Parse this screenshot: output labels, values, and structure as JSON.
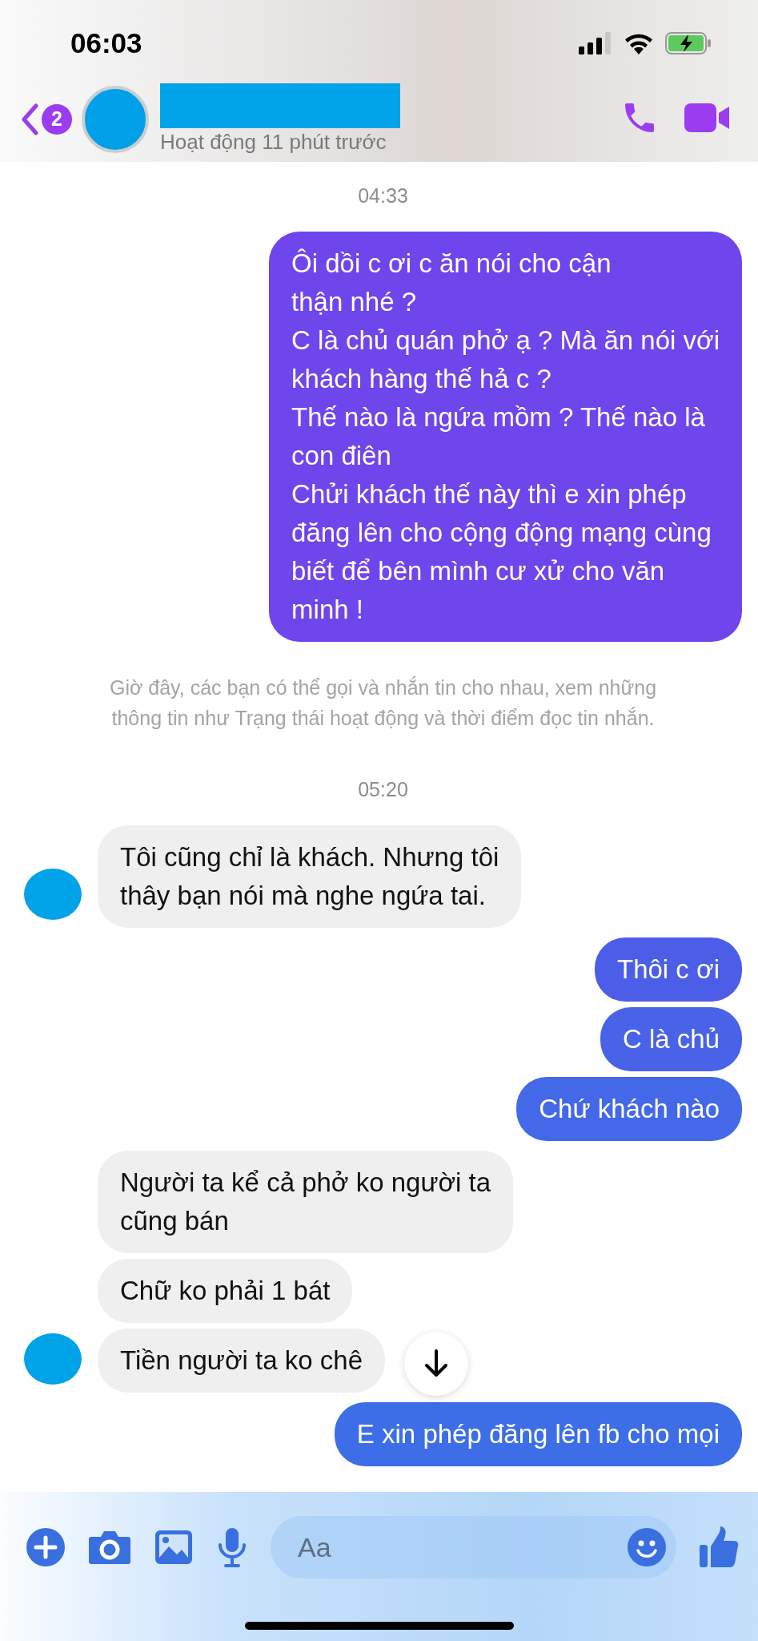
{
  "status_bar": {
    "time": "06:03"
  },
  "header": {
    "unread_badge": "2",
    "status": "Hoạt động 11 phút trước"
  },
  "messages": [
    {
      "kind": "time",
      "text": "04:33"
    },
    {
      "kind": "sent",
      "bubbles": [
        {
          "text": "Ôi dồi c ơi c ăn nói cho cận\nthận nhé ?\nC là chủ quán phở ạ ? Mà ăn nói với\nkhách hàng thế hả c ?\nThế nào là ngứa mồm ? Thế nào là\ncon điên\nChửi khách thế này thì e xin phép\nđăng lên cho cộng động mạng cùng\nbiết để bên mình cư xử cho văn\nminh !",
          "color": "#6f45ec"
        }
      ]
    },
    {
      "kind": "notice",
      "text": "Giờ đây, các bạn có thể gọi và nhắn tin cho nhau, xem những\nthông tin như Trạng thái hoạt động và thời điểm đọc tin nhắn."
    },
    {
      "kind": "time",
      "text": "05:20"
    },
    {
      "kind": "received",
      "bubbles": [
        {
          "text": "Tôi cũng chỉ là khách. Nhưng tôi\nthây bạn nói mà nghe ngứa tai."
        }
      ]
    },
    {
      "kind": "sent",
      "bubbles": [
        {
          "text": "Thôi c ơi",
          "color": "#4c5ee8"
        },
        {
          "text": "C là chủ",
          "color": "#4862e8"
        },
        {
          "text": "Chứ khách nào",
          "color": "#4368e8"
        }
      ]
    },
    {
      "kind": "received",
      "bubbles": [
        {
          "text": "Người ta kể cả phở ko người ta\ncũng bán"
        },
        {
          "text": "Chữ ko phải 1 bát"
        },
        {
          "text": "Tiền người ta ko chê"
        }
      ]
    },
    {
      "kind": "sent",
      "bubbles": [
        {
          "text": "E xin phép đăng lên fb cho mọi",
          "color": "#3d6ee8"
        }
      ]
    }
  ],
  "composer": {
    "placeholder": "Aa"
  }
}
